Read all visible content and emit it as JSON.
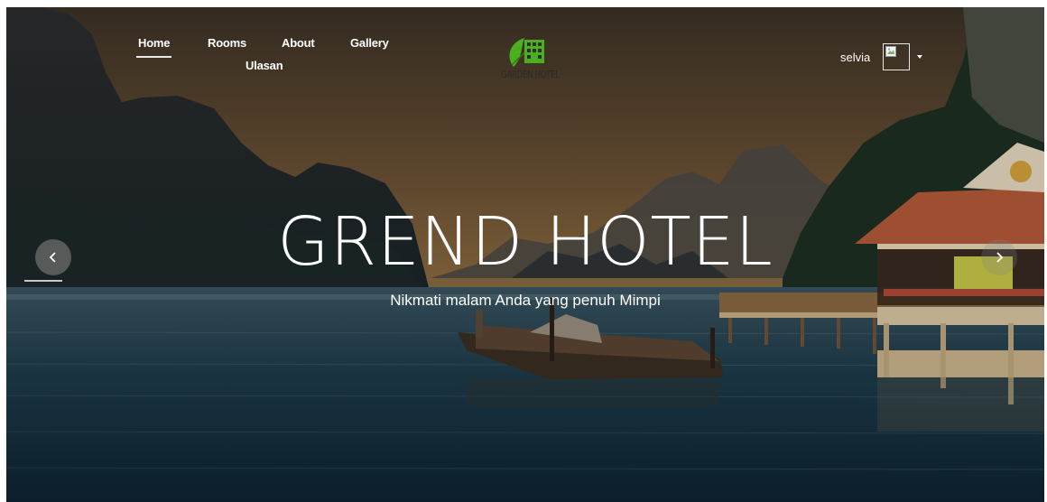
{
  "nav": {
    "home": "Home",
    "rooms": "Rooms",
    "about": "About",
    "gallery": "Gallery",
    "ulasan": "Ulasan"
  },
  "logo": {
    "text": "GARDEN HOTEL",
    "icon": "leaf-building-logo-icon",
    "color": "#4caf1f"
  },
  "user": {
    "name": "selvia",
    "avatar_icon": "broken-image-icon",
    "dropdown_icon": "caret-down-icon"
  },
  "hero": {
    "title": "GREND HOTEL",
    "subtitle": "Nikmati malam Anda yang penuh Mimpi"
  },
  "carousel": {
    "prev_icon": "chevron-left-icon",
    "next_icon": "chevron-right-icon"
  }
}
